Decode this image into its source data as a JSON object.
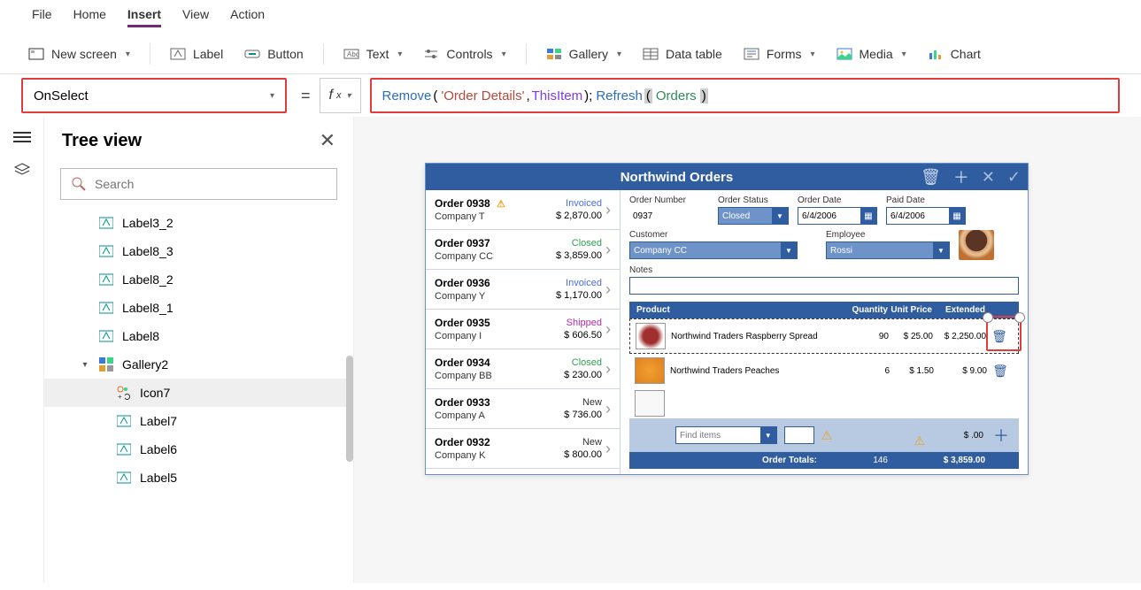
{
  "menubar": {
    "tabs": [
      "File",
      "Home",
      "Insert",
      "View",
      "Action"
    ],
    "active": "Insert"
  },
  "toolbar": {
    "new_screen": "New screen",
    "label": "Label",
    "button": "Button",
    "text": "Text",
    "controls": "Controls",
    "gallery": "Gallery",
    "data_table": "Data table",
    "forms": "Forms",
    "media": "Media",
    "chart": "Chart"
  },
  "formula": {
    "property": "OnSelect",
    "tokens": {
      "remove": "Remove",
      "lp1": "(",
      "sp": " ",
      "ds": "'Order Details'",
      "comma": ", ",
      "this": "ThisItem",
      "rp1": " );",
      "refresh": "Refresh",
      "lp2": "(",
      "orders": "Orders",
      "rp2": ")"
    }
  },
  "tree": {
    "title": "Tree view",
    "search_placeholder": "Search",
    "items": [
      {
        "name": "Label3_2",
        "type": "label",
        "indent": 0
      },
      {
        "name": "Label8_3",
        "type": "label",
        "indent": 0
      },
      {
        "name": "Label8_2",
        "type": "label",
        "indent": 0
      },
      {
        "name": "Label8_1",
        "type": "label",
        "indent": 0
      },
      {
        "name": "Label8",
        "type": "label",
        "indent": 0
      },
      {
        "name": "Gallery2",
        "type": "gallery",
        "indent": 0,
        "expanded": true
      },
      {
        "name": "Icon7",
        "type": "icon",
        "indent": 1,
        "selected": true
      },
      {
        "name": "Label7",
        "type": "label",
        "indent": 1
      },
      {
        "name": "Label6",
        "type": "label",
        "indent": 1
      },
      {
        "name": "Label5",
        "type": "label",
        "indent": 1
      }
    ]
  },
  "app": {
    "title": "Northwind Orders",
    "orders": [
      {
        "no": "Order 0938",
        "co": "Company T",
        "status": "Invoiced",
        "status_cls": "st-invoiced",
        "amount": "$ 2,870.00",
        "warn": true
      },
      {
        "no": "Order 0937",
        "co": "Company CC",
        "status": "Closed",
        "status_cls": "st-closed",
        "amount": "$ 3,859.00"
      },
      {
        "no": "Order 0936",
        "co": "Company Y",
        "status": "Invoiced",
        "status_cls": "st-invoiced",
        "amount": "$ 1,170.00"
      },
      {
        "no": "Order 0935",
        "co": "Company I",
        "status": "Shipped",
        "status_cls": "st-shipped",
        "amount": "$ 606.50"
      },
      {
        "no": "Order 0934",
        "co": "Company BB",
        "status": "Closed",
        "status_cls": "st-closed",
        "amount": "$ 230.00"
      },
      {
        "no": "Order 0933",
        "co": "Company A",
        "status": "New",
        "status_cls": "st-new",
        "amount": "$ 736.00"
      },
      {
        "no": "Order 0932",
        "co": "Company K",
        "status": "New",
        "status_cls": "st-new",
        "amount": "$ 800.00"
      }
    ],
    "detail": {
      "order_number_lbl": "Order Number",
      "order_number": "0937",
      "order_status_lbl": "Order Status",
      "order_status": "Closed",
      "order_date_lbl": "Order Date",
      "order_date": "6/4/2006",
      "paid_date_lbl": "Paid Date",
      "paid_date": "6/4/2006",
      "customer_lbl": "Customer",
      "customer": "Company CC",
      "employee_lbl": "Employee",
      "employee": "Rossi",
      "notes_lbl": "Notes"
    },
    "line_hdr": {
      "product": "Product",
      "qty": "Quantity",
      "price": "Unit Price",
      "ext": "Extended"
    },
    "lines": [
      {
        "name": "Northwind Traders Raspberry Spread",
        "qty": "90",
        "price": "$ 25.00",
        "ext": "$ 2,250.00",
        "thumb": "thumb-red",
        "selected": true
      },
      {
        "name": "Northwind Traders Peaches",
        "qty": "6",
        "price": "$ 1.50",
        "ext": "$ 9.00",
        "thumb": "thumb-org"
      }
    ],
    "add": {
      "find": "Find items",
      "amount": "$ .00"
    },
    "totals": {
      "label": "Order Totals:",
      "qty": "146",
      "amount": "$ 3,859.00"
    }
  }
}
